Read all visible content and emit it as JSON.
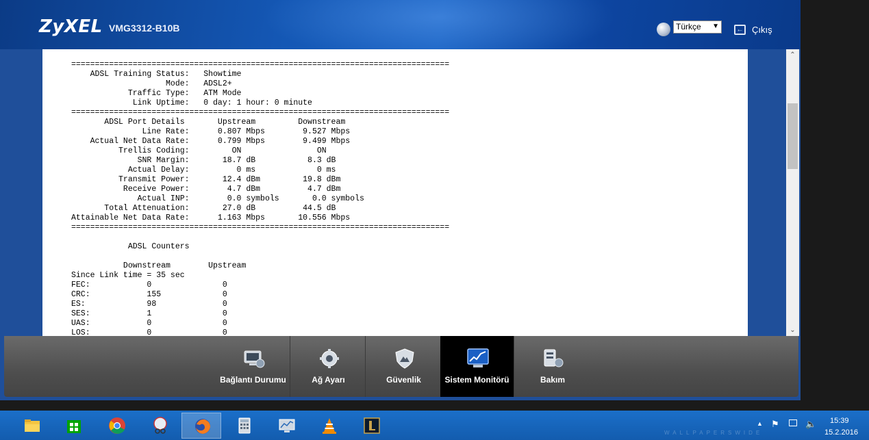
{
  "header": {
    "brand": "ZyXEL",
    "model": "VMG3312-B10B",
    "language_selected": "Türkçe",
    "logout_label": "Çıkış"
  },
  "status_text": "Durum:\n\n================================================================================\n    ADSL Training Status:   Showtime\n                    Mode:   ADSL2+\n            Traffic Type:   ATM Mode\n             Link Uptime:   0 day: 1 hour: 0 minute\n================================================================================\n       ADSL Port Details       Upstream         Downstream\n               Line Rate:      0.807 Mbps        9.527 Mbps\n    Actual Net Data Rate:      0.799 Mbps        9.499 Mbps\n          Trellis Coding:         ON                ON\n              SNR Margin:       18.7 dB           8.3 dB\n            Actual Delay:          0 ms             0 ms\n          Transmit Power:       12.4 dBm         19.8 dBm\n           Receive Power:        4.7 dBm          4.7 dBm\n              Actual INP:        0.0 symbols       0.0 symbols\n       Total Attenuation:       27.0 dB          44.5 dB\nAttainable Net Data Rate:      1.163 Mbps       10.556 Mbps\n================================================================================\n\n            ADSL Counters\n\n           Downstream        Upstream\nSince Link time = 35 sec\nFEC:            0               0\nCRC:            155             0\nES:             98              0\nSES:            1               0\nUAS:            0               0\nLOS:            0               0",
  "nav": {
    "items": [
      {
        "label": "Bağlantı Durumu"
      },
      {
        "label": "Ağ Ayarı"
      },
      {
        "label": "Güvenlik"
      },
      {
        "label": "Sistem Monitörü"
      },
      {
        "label": "Bakım"
      }
    ],
    "active_index": 3
  },
  "taskbar": {
    "time": "15:39",
    "date": "15.2.2016",
    "watermark": "WALLPAPERSWIDE"
  },
  "colors": {
    "header_blue": "#1457b4",
    "nav_gray": "#555555",
    "nav_active": "#000000",
    "taskbar_blue": "#1b6fc9"
  }
}
